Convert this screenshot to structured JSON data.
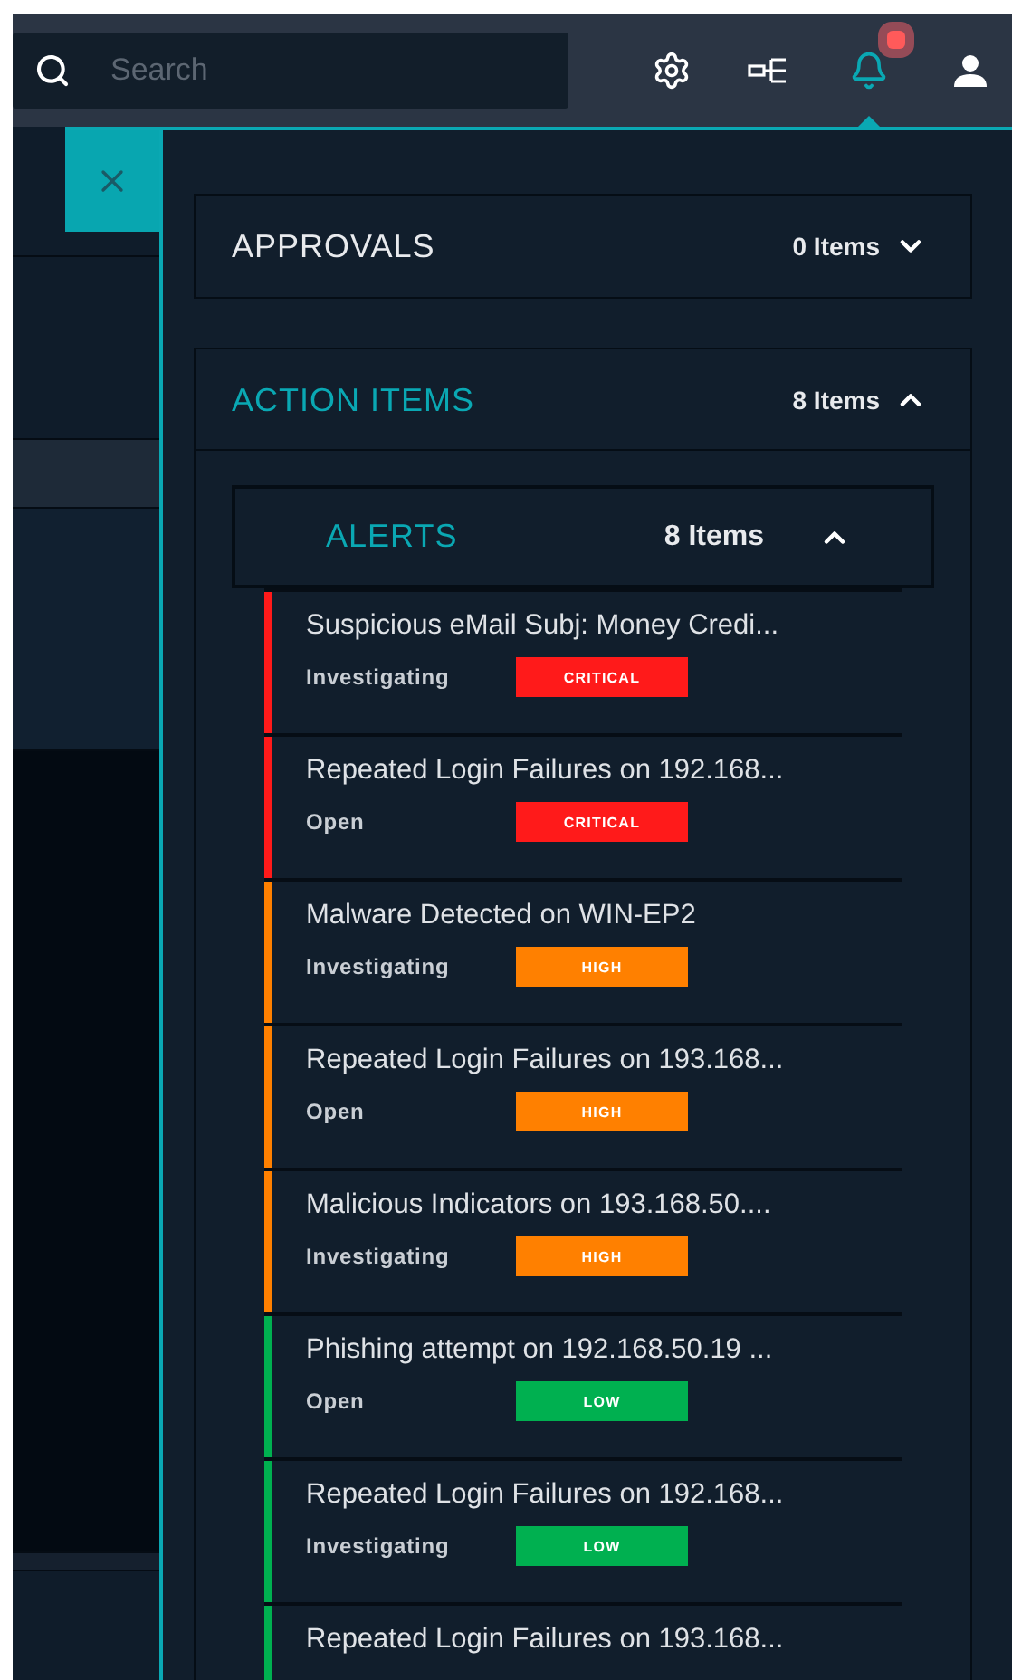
{
  "search": {
    "placeholder": "Search"
  },
  "notifications": {
    "unread": true
  },
  "sections": [
    {
      "title": "APPROVALS",
      "count": "0 Items",
      "expanded": false
    },
    {
      "title": "ACTION ITEMS",
      "count": "8 Items",
      "expanded": true,
      "groups": [
        {
          "title": "ALERTS",
          "count": "8 Items",
          "expanded": true,
          "alerts": [
            {
              "title": "Suspicious eMail Subj: Money Credi...",
              "status": "Investigating",
              "severity": "CRITICAL",
              "color": "#ff1a1a"
            },
            {
              "title": "Repeated Login Failures on 192.168...",
              "status": "Open",
              "severity": "CRITICAL",
              "color": "#ff1a1a"
            },
            {
              "title": "Malware Detected on WIN-EP2",
              "status": "Investigating",
              "severity": "HIGH",
              "color": "#ff8000"
            },
            {
              "title": "Repeated Login Failures on 193.168...",
              "status": "Open",
              "severity": "HIGH",
              "color": "#ff8000"
            },
            {
              "title": "Malicious Indicators on 193.168.50....",
              "status": "Investigating",
              "severity": "HIGH",
              "color": "#ff8000"
            },
            {
              "title": "Phishing attempt on 192.168.50.19 ...",
              "status": "Open",
              "severity": "LOW",
              "color": "#00b050"
            },
            {
              "title": "Repeated Login Failures on 192.168...",
              "status": "Investigating",
              "severity": "LOW",
              "color": "#00b050"
            },
            {
              "title": "Repeated Login Failures on 193.168...",
              "color": "#00b050"
            }
          ]
        }
      ]
    }
  ]
}
